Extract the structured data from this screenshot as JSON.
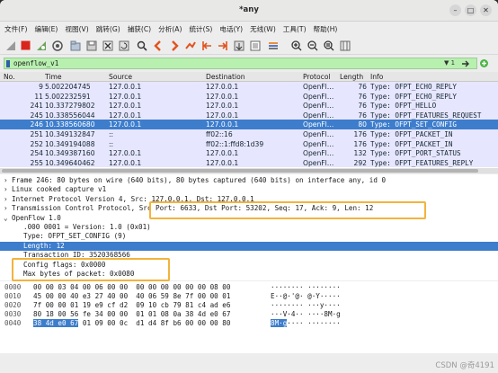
{
  "window": {
    "title": "*any",
    "minimize": "–",
    "maximize": "□",
    "close": "✕"
  },
  "menu": [
    "文件(F)",
    "编辑(E)",
    "视图(V)",
    "跳转(G)",
    "捕获(C)",
    "分析(A)",
    "统计(S)",
    "电话(Y)",
    "无线(W)",
    "工具(T)",
    "帮助(H)"
  ],
  "filter": {
    "value": "openflow_v1",
    "dropdown_label": "▼ 1",
    "apply_icon": "arrow-right-icon",
    "add_icon": "plus-icon"
  },
  "packet_list": {
    "columns": [
      "No.",
      "Time",
      "Source",
      "Destination",
      "Protocol",
      "Length",
      "Info"
    ],
    "rows": [
      {
        "no": "9",
        "time": "5.002204745",
        "src": "127.0.0.1",
        "dst": "127.0.0.1",
        "proto": "OpenFl…",
        "len": "76",
        "info": "Type: OFPT_ECHO_REPLY",
        "bg": "#e7e6ff",
        "fg": "#12272e"
      },
      {
        "no": "11",
        "time": "5.002232591",
        "src": "127.0.0.1",
        "dst": "127.0.0.1",
        "proto": "OpenFl…",
        "len": "76",
        "info": "Type: OFPT_ECHO_REPLY",
        "bg": "#e7e6ff",
        "fg": "#12272e"
      },
      {
        "no": "241",
        "time": "10.337279802",
        "src": "127.0.0.1",
        "dst": "127.0.0.1",
        "proto": "OpenFl…",
        "len": "76",
        "info": "Type: OFPT_HELLO",
        "bg": "#e7e6ff",
        "fg": "#12272e"
      },
      {
        "no": "245",
        "time": "10.338556044",
        "src": "127.0.0.1",
        "dst": "127.0.0.1",
        "proto": "OpenFl…",
        "len": "76",
        "info": "Type: OFPT_FEATURES_REQUEST",
        "bg": "#e7e6ff",
        "fg": "#12272e"
      },
      {
        "no": "246",
        "time": "10.338560680",
        "src": "127.0.0.1",
        "dst": "127.0.0.1",
        "proto": "OpenFl…",
        "len": "80",
        "info": "Type: OFPT_SET_CONFIG",
        "bg": "#3d7dcc",
        "fg": "#ffffff"
      },
      {
        "no": "251",
        "time": "10.349132847",
        "src": "::",
        "dst": "ff02::16",
        "proto": "OpenFl…",
        "len": "176",
        "info": "Type: OFPT_PACKET_IN",
        "bg": "#e7e6ff",
        "fg": "#12272e"
      },
      {
        "no": "252",
        "time": "10.349194088",
        "src": "::",
        "dst": "ff02::1:ffd8:1d39",
        "proto": "OpenFl…",
        "len": "176",
        "info": "Type: OFPT_PACKET_IN",
        "bg": "#e7e6ff",
        "fg": "#12272e"
      },
      {
        "no": "254",
        "time": "10.349387160",
        "src": "127.0.0.1",
        "dst": "127.0.0.1",
        "proto": "OpenFl…",
        "len": "132",
        "info": "Type: OFPT_PORT_STATUS",
        "bg": "#e7e6ff",
        "fg": "#12272e"
      },
      {
        "no": "255",
        "time": "10.349640462",
        "src": "127.0.0.1",
        "dst": "127.0.0.1",
        "proto": "OpenFl…",
        "len": "292",
        "info": "Type: OFPT_FEATURES_REPLY",
        "bg": "#e7e6ff",
        "fg": "#12272e"
      }
    ]
  },
  "details": [
    {
      "text": "Frame 246: 80 bytes on wire (640 bits), 80 bytes captured (640 bits) on interface any, id 0",
      "arrow": "›",
      "indent": 0,
      "selected": false
    },
    {
      "text": "Linux cooked capture v1",
      "arrow": "›",
      "indent": 0,
      "selected": false
    },
    {
      "text": "Internet Protocol Version 4, Src: 127.0.0.1, Dst: 127.0.0.1",
      "arrow": "›",
      "indent": 0,
      "selected": false
    },
    {
      "text": "Transmission Control Protocol, Src Port: 6633, Dst Port: 53202, Seq: 17, Ack: 9, Len: 12",
      "arrow": "›",
      "indent": 0,
      "selected": false
    },
    {
      "text": "OpenFlow 1.0",
      "arrow": "⌄",
      "indent": 0,
      "selected": false
    },
    {
      "text": ".000 0001 = Version: 1.0 (0x01)",
      "arrow": "",
      "indent": 1,
      "selected": false
    },
    {
      "text": "Type: OFPT_SET_CONFIG (9)",
      "arrow": "",
      "indent": 1,
      "selected": false
    },
    {
      "text": "Length: 12",
      "arrow": "",
      "indent": 1,
      "selected": true
    },
    {
      "text": "Transaction ID: 3520368566",
      "arrow": "",
      "indent": 1,
      "selected": false
    },
    {
      "text": "Config flags: 0x0000",
      "arrow": "",
      "indent": 1,
      "selected": false
    },
    {
      "text": "Max bytes of packet: 0x0080",
      "arrow": "",
      "indent": 1,
      "selected": false
    }
  ],
  "bytes": [
    {
      "offset": "0000",
      "hex": "00 00 03 04 00 06 00 00  00 00 00 00 00 00 08 00",
      "ascii": "········ ········"
    },
    {
      "offset": "0010",
      "hex": "45 00 00 40 e3 27 40 00  40 06 59 8e 7f 00 00 01",
      "ascii": "E··@·'@· @·Y·····"
    },
    {
      "offset": "0020",
      "hex": "7f 00 00 01 19 e9 cf d2  09 10 cb 79 81 c4 ad e6",
      "ascii": "········ ···y····"
    },
    {
      "offset": "0030",
      "hex": "80 18 00 56 fe 34 00 00  01 01 08 0a 38 4d e0 67",
      "ascii": "···V·4·· ····8M·g"
    },
    {
      "offset": "0040",
      "hex": "38 4d e0 67 01 09 00 0c  d1 d4 8f b6 00 00 00 80",
      "ascii": "8M·g···· ········",
      "hl_hex": "38 4d e0 67",
      "hl_ascii": "8M·g"
    }
  ],
  "watermark": "CSDN @奇4191",
  "colors": {
    "selected_row": "#3d7dcc",
    "openflow_row": "#e7e6ff",
    "filter_ok": "#b8f0b0",
    "annotation": "#f2b33d"
  }
}
